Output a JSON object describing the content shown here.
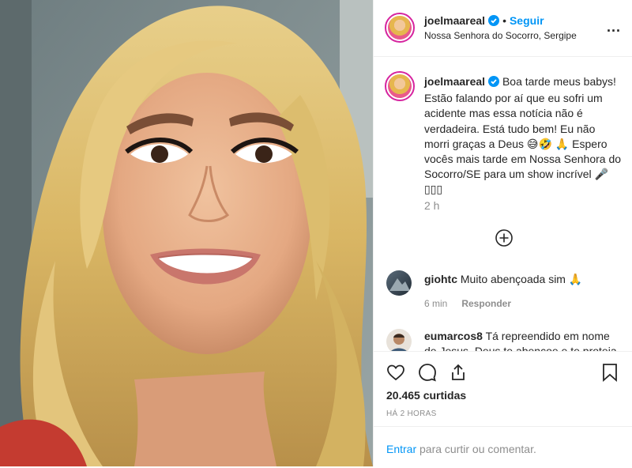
{
  "post": {
    "username": "joelmaareal",
    "follow_label": "Seguir",
    "separator": "•",
    "location": "Nossa Senhora do Socorro, Sergipe",
    "more_label": "...",
    "photo_alt_icon": "selfie-photo",
    "verified_icon": "verified-badge-icon"
  },
  "caption": {
    "username": "joelmaareal",
    "text": "Boa tarde meus babys! Estão falando por aí que eu sofri um acidente mas essa notícia não é verdadeira. Está tudo bem! Eu não morri graças a Deus 😅🤣 🙏 Espero vocês mais tarde em Nossa Senhora do Socorro/SE para um show incrível 🎤 ▯▯▯",
    "time": "2 h"
  },
  "comments": [
    {
      "username": "giohtc",
      "text": "Muito abençoada sim 🙏",
      "time": "6 min",
      "reply_label": "Responder"
    },
    {
      "username": "eumarcos8",
      "text": "Tá repreendido em nome de Jesus. Deus te abençoe e te proteja"
    }
  ],
  "actions": {
    "likes": "20.465 curtidas",
    "posted_ago": "HÁ 2 HORAS"
  },
  "login": {
    "link": "Entrar",
    "rest": "para curtir ou comentar."
  },
  "colors": {
    "accent": "#0095f6",
    "muted": "#8e8e8e",
    "text": "#262626",
    "border": "#efefef"
  }
}
